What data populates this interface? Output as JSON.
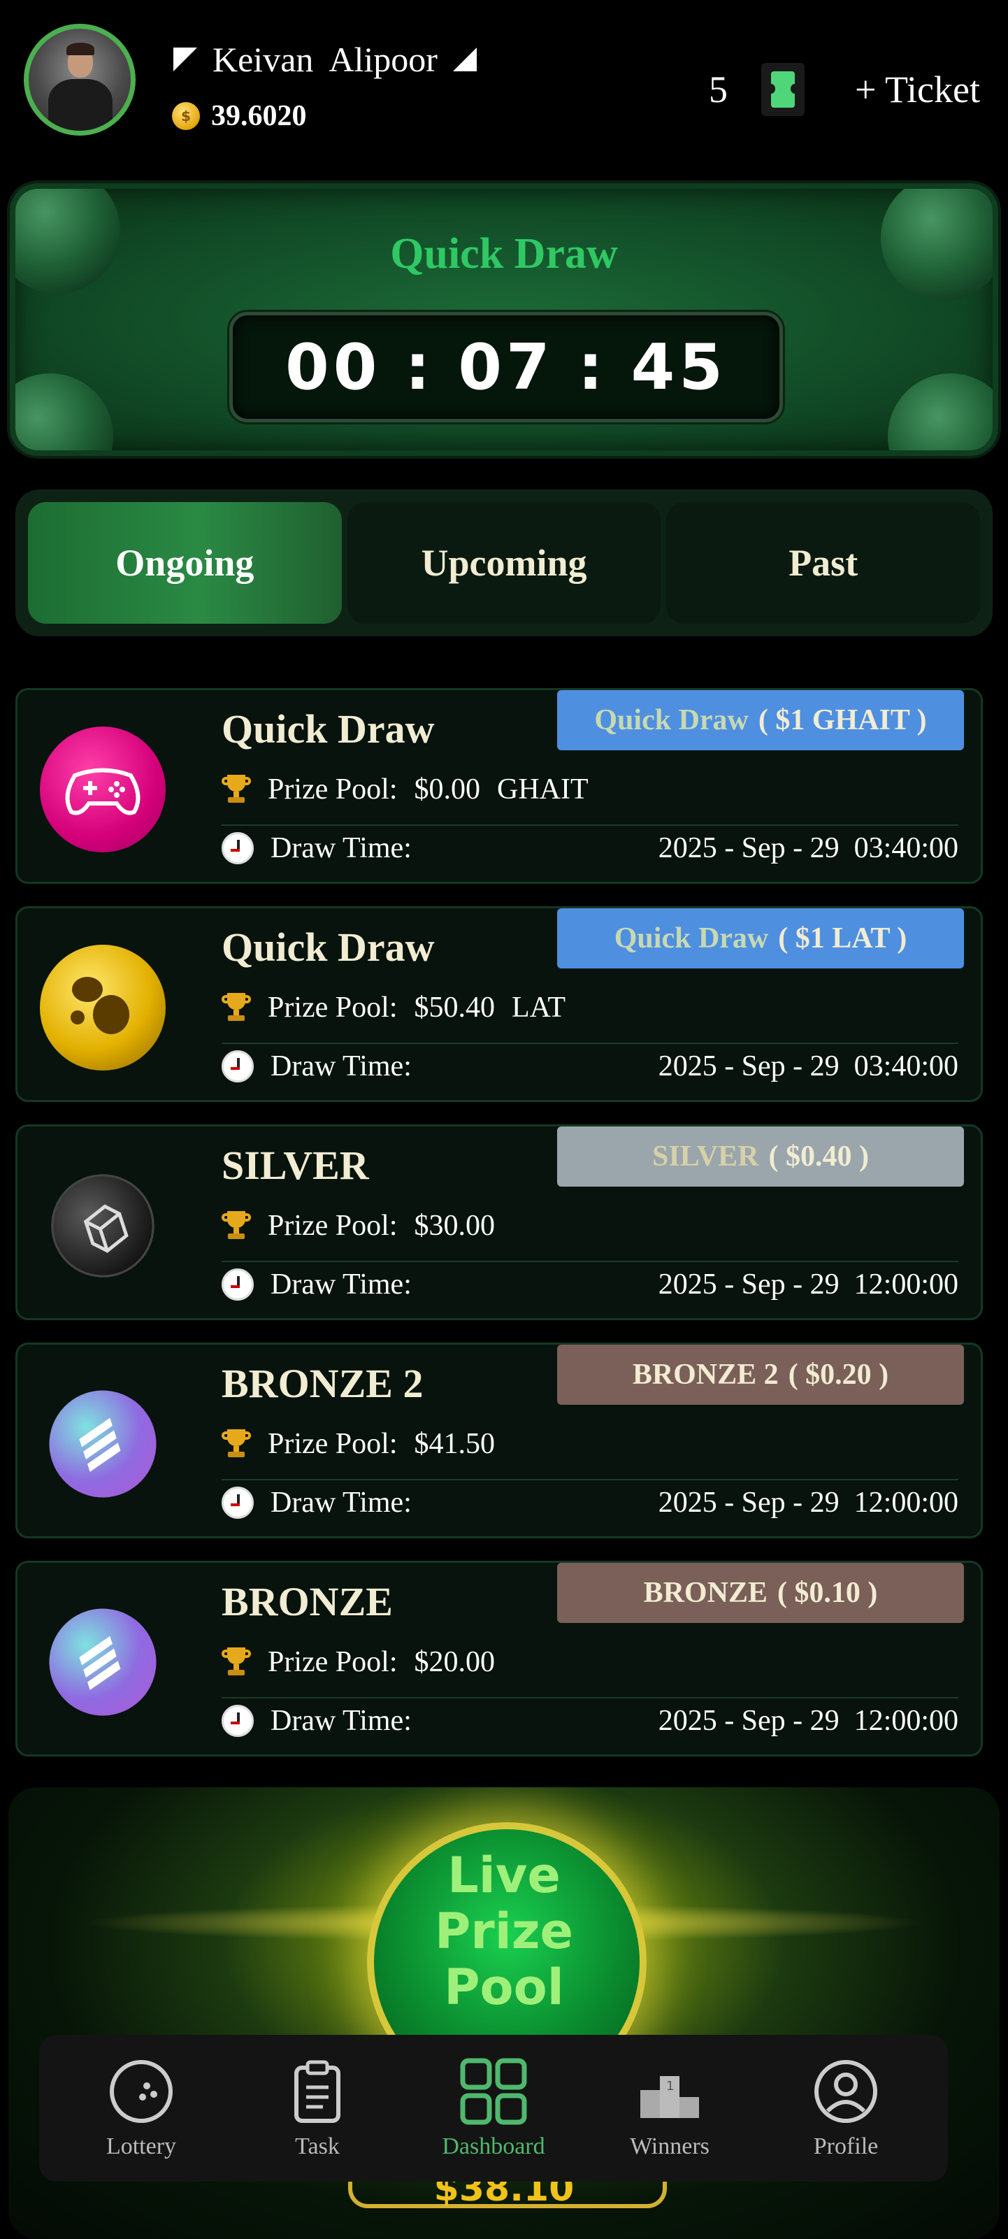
{
  "header": {
    "first_name": "Keivan",
    "last_name": "Alipoor",
    "balance": "39.6020",
    "ticket_count": "5",
    "add_ticket_label": "+ Ticket"
  },
  "banner": {
    "title": "Quick Draw",
    "timer": {
      "hours": "00",
      "minutes": "07",
      "seconds": "45",
      "separator": ":"
    }
  },
  "tabs": [
    {
      "label": "Ongoing",
      "active": true
    },
    {
      "label": "Upcoming",
      "active": false
    },
    {
      "label": "Past",
      "active": false
    }
  ],
  "labels": {
    "prize_pool": "Prize Pool:",
    "draw_time": "Draw Time:"
  },
  "draws": [
    {
      "title": "Quick Draw",
      "badge_name": "Quick Draw",
      "badge_price": "( $1 GHAIT )",
      "badge_color": "#4f8fe0",
      "badge_name_color": "#c7d9b0",
      "prize": "$0.00",
      "currency": "GHAIT",
      "draw_time": "2025 - Sep - 29  03:40:00",
      "icon": "gamepad-icon"
    },
    {
      "title": "Quick Draw",
      "badge_name": "Quick Draw",
      "badge_price": "( $1 LAT )",
      "badge_color": "#4f8fe0",
      "badge_name_color": "#c7d9b0",
      "prize": "$50.40",
      "currency": "LAT",
      "draw_time": "2025 - Sep - 29  03:40:00",
      "icon": "gold-coin-icon"
    },
    {
      "title": "SILVER",
      "badge_name": "SILVER",
      "badge_price": "( $0.40 )",
      "badge_color": "#9aa6ab",
      "badge_name_color": "#d6d1a8",
      "prize": "$30.00",
      "currency": "",
      "draw_time": "2025 - Sep - 29  12:00:00",
      "icon": "silver-coin-icon"
    },
    {
      "title": "BRONZE 2",
      "badge_name": "BRONZE 2",
      "badge_price": "( $0.20 )",
      "badge_color": "#7a6058",
      "badge_name_color": "#f1ecd2",
      "prize": "$41.50",
      "currency": "",
      "draw_time": "2025 - Sep - 29  12:00:00",
      "icon": "bronze-coin-icon"
    },
    {
      "title": "BRONZE",
      "badge_name": "BRONZE",
      "badge_price": "( $0.10 )",
      "badge_color": "#7a6058",
      "badge_name_color": "#f1ecd2",
      "prize": "$20.00",
      "currency": "",
      "draw_time": "2025 - Sep - 29  12:00:00",
      "icon": "bronze-coin-icon"
    }
  ],
  "live_pool": {
    "line1": "Live",
    "line2": "Prize",
    "line3": "Pool",
    "amount": "$38.10"
  },
  "nav": [
    {
      "label": "Lottery",
      "icon": "lottery-ball-icon",
      "active": false
    },
    {
      "label": "Task",
      "icon": "clipboard-icon",
      "active": false
    },
    {
      "label": "Dashboard",
      "icon": "dashboard-grid-icon",
      "active": true
    },
    {
      "label": "Winners",
      "icon": "podium-icon",
      "active": false
    },
    {
      "label": "Profile",
      "icon": "user-circle-icon",
      "active": false
    }
  ],
  "colors": {
    "accent": "#4caf50",
    "banner_title": "#2fc864",
    "nav_active": "#4fb86e",
    "card_bg": "#07130c"
  }
}
